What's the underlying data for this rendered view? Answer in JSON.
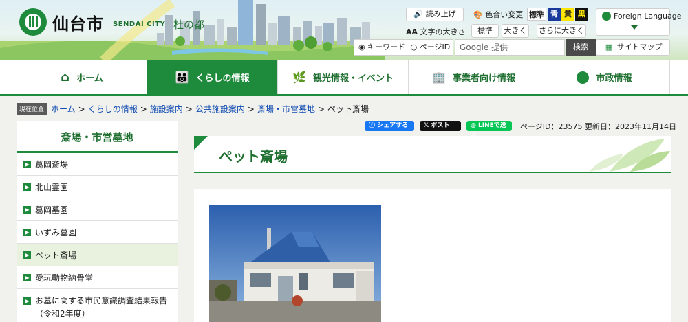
{
  "header": {
    "city_name": "仙台市",
    "city_en": "SENDAI CITY",
    "tagline": "杜の都",
    "read_aloud": "読み上げ",
    "color_change": "色合い変更",
    "color_options": [
      "標準",
      "青",
      "黄",
      "黒"
    ],
    "text_size_label": "文字の大きさ",
    "text_size_options": [
      "標準",
      "大きく",
      "さらに大きく"
    ],
    "foreign_language": "Foreign Language",
    "search": {
      "mode_keyword": "キーワード",
      "mode_page_id": "ページID",
      "placeholder": "Google 提供",
      "button": "検索"
    },
    "sitemap": "サイトマップ"
  },
  "nav": {
    "items": [
      {
        "label": "ホーム"
      },
      {
        "label": "くらしの情報"
      },
      {
        "label": "観光情報・イベント"
      },
      {
        "label": "事業者向け情報"
      },
      {
        "label": "市政情報"
      }
    ]
  },
  "breadcrumb": {
    "badge": "現在位置",
    "links": [
      "ホーム",
      "くらしの情報",
      "施設案内",
      "公共施設案内",
      "斎場・市営墓地"
    ],
    "current": "ペット斎場"
  },
  "share": {
    "facebook": "シェアする",
    "x": "ポスト",
    "line": "LINEで送る",
    "page_id": "ページID：23575",
    "updated": "更新日：2023年11月14日"
  },
  "sidebar": {
    "title": "斎場・市営墓地",
    "items": [
      {
        "label": "葛岡斎場"
      },
      {
        "label": "北山霊園"
      },
      {
        "label": "葛岡墓園"
      },
      {
        "label": "いずみ墓園"
      },
      {
        "label": "ペット斎場"
      },
      {
        "label": "愛玩動物納骨堂"
      },
      {
        "label": "お墓に関する市民意識調査結果報告（令和2年度）"
      }
    ]
  },
  "main": {
    "title": "ペット斎場"
  },
  "colors": {
    "brand_green": "#1e8a3c",
    "link_blue": "#0f4bb0",
    "facebook": "#1877f2",
    "line": "#06c755"
  }
}
